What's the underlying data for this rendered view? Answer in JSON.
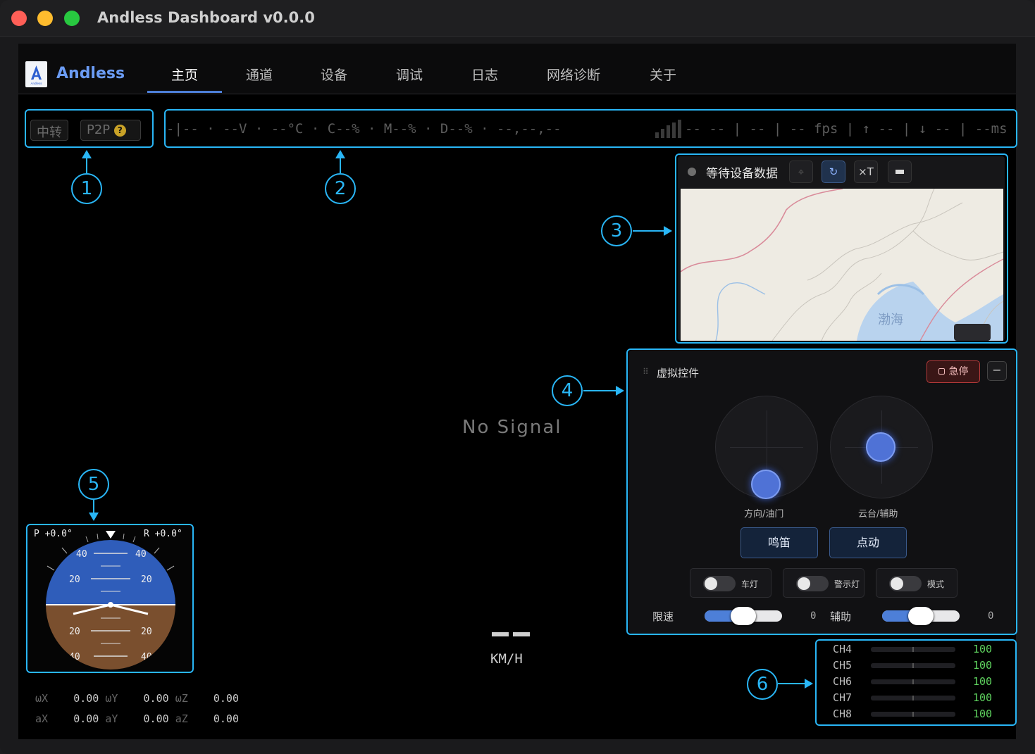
{
  "window": {
    "title": "Andless Dashboard v0.0.0"
  },
  "nav": {
    "brand": "Andless",
    "logo_text": "Andless",
    "tabs": [
      {
        "label": "主页",
        "active": true
      },
      {
        "label": "通道"
      },
      {
        "label": "设备"
      },
      {
        "label": "调试"
      },
      {
        "label": "日志"
      },
      {
        "label": "网络诊断"
      },
      {
        "label": "关于"
      }
    ]
  },
  "connection": {
    "relay_label": "中转",
    "p2p_label": "P2P",
    "help_icon": "question-icon",
    "help_glyph": "?"
  },
  "telemetry": {
    "left": "-|-- · --V · --°C · C--% · M--% · D--% · --,--,--",
    "right": "-- -- | -- | -- fps | ↑ -- | ↓ -- | --ms",
    "signal_icon": "signal-bars-icon"
  },
  "video": {
    "no_signal": "No Signal",
    "speed_unit": "KM/H"
  },
  "map": {
    "status": "等待设备数据",
    "tool_locate_icon": "crosshair-icon",
    "tool_refresh_icon": "refresh-icon",
    "tool_refresh_glyph": "↻",
    "tool_clear_label": "×T",
    "tool_minimize_icon": "minimize-icon",
    "sea_label": "渤海"
  },
  "controls": {
    "title": "虚拟控件",
    "estop_label": "急停",
    "minimize_glyph": "−",
    "joysticks": [
      {
        "label": "方向/油门"
      },
      {
        "label": "云台/辅助"
      }
    ],
    "buttons": [
      {
        "label": "鸣笛"
      },
      {
        "label": "点动"
      }
    ],
    "toggles": [
      {
        "label": "车灯",
        "on": false
      },
      {
        "label": "警示灯",
        "on": false
      },
      {
        "label": "模式",
        "on": false
      }
    ],
    "sliders": [
      {
        "label": "限速",
        "value": "0",
        "level": 0.5
      },
      {
        "label": "辅助",
        "value": "0",
        "level": 0.5
      }
    ]
  },
  "attitude": {
    "pitch": "P +0.0°",
    "roll": "R +0.0°",
    "scale": [
      "40",
      "20",
      "20",
      "40"
    ],
    "sky_color": "#2f5dba",
    "ground_color": "#7a4f2e"
  },
  "imu": {
    "rows": [
      {
        "k1": "ωX",
        "v1": "0.00",
        "k2": "ωY",
        "v2": "0.00",
        "k3": "ωZ",
        "v3": "0.00"
      },
      {
        "k1": "aX",
        "v1": "0.00",
        "k2": "aY",
        "v2": "0.00",
        "k3": "aZ",
        "v3": "0.00"
      }
    ]
  },
  "channels": [
    {
      "name": "CH4",
      "value": "100"
    },
    {
      "name": "CH5",
      "value": "100"
    },
    {
      "name": "CH6",
      "value": "100"
    },
    {
      "name": "CH7",
      "value": "100"
    },
    {
      "name": "CH8",
      "value": "100"
    }
  ],
  "callouts": [
    "1",
    "2",
    "3",
    "4",
    "5",
    "6"
  ],
  "colors": {
    "accent": "#29b6f6",
    "brand": "#6b9cf5",
    "estop": "#b63a3a",
    "channel_value": "#5fd35f"
  }
}
